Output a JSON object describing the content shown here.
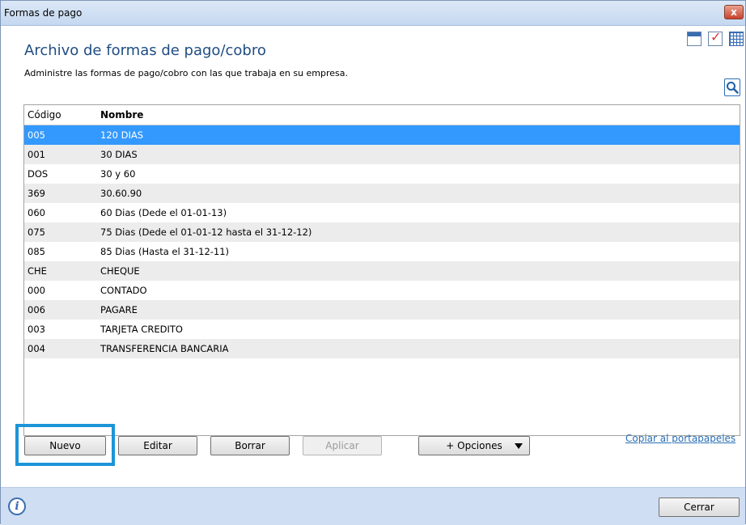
{
  "window": {
    "title": "Formas de pago",
    "close_glyph": "x"
  },
  "header": {
    "heading": "Archivo de formas de pago/cobro",
    "subtitle": "Administre las formas de pago/cobro con las que trabaja en su empresa."
  },
  "toolbar_icons": [
    "calendar-icon",
    "checklist-icon",
    "grid-icon"
  ],
  "table": {
    "columns": [
      "Código",
      "Nombre"
    ],
    "rows": [
      {
        "code": "005",
        "name": "120 DIAS",
        "selected": true
      },
      {
        "code": "001",
        "name": "30 DIAS"
      },
      {
        "code": "DOS",
        "name": "30 y 60"
      },
      {
        "code": "369",
        "name": "30.60.90"
      },
      {
        "code": "060",
        "name": "60 Dias (Dede el 01-01-13)"
      },
      {
        "code": "075",
        "name": "75 Dias (Dede el 01-01-12 hasta el 31-12-12)"
      },
      {
        "code": "085",
        "name": "85 Dias (Hasta el 31-12-11)"
      },
      {
        "code": "CHE",
        "name": "CHEQUE"
      },
      {
        "code": "000",
        "name": "CONTADO"
      },
      {
        "code": "006",
        "name": "PAGARE"
      },
      {
        "code": "003",
        "name": "TARJETA CREDITO"
      },
      {
        "code": "004",
        "name": "TRANSFERENCIA BANCARIA"
      }
    ]
  },
  "actions": {
    "nuevo": "Nuevo",
    "editar": "Editar",
    "borrar": "Borrar",
    "aplicar": "Aplicar",
    "opciones": "+ Opciones",
    "copiar": "Copiar al portapapeles"
  },
  "footer": {
    "info_glyph": "i",
    "cerrar": "Cerrar"
  },
  "colors": {
    "selection": "#3399ff",
    "heading": "#1f4d82",
    "highlight": "#1c95d8",
    "footer": "#cfdef2"
  }
}
